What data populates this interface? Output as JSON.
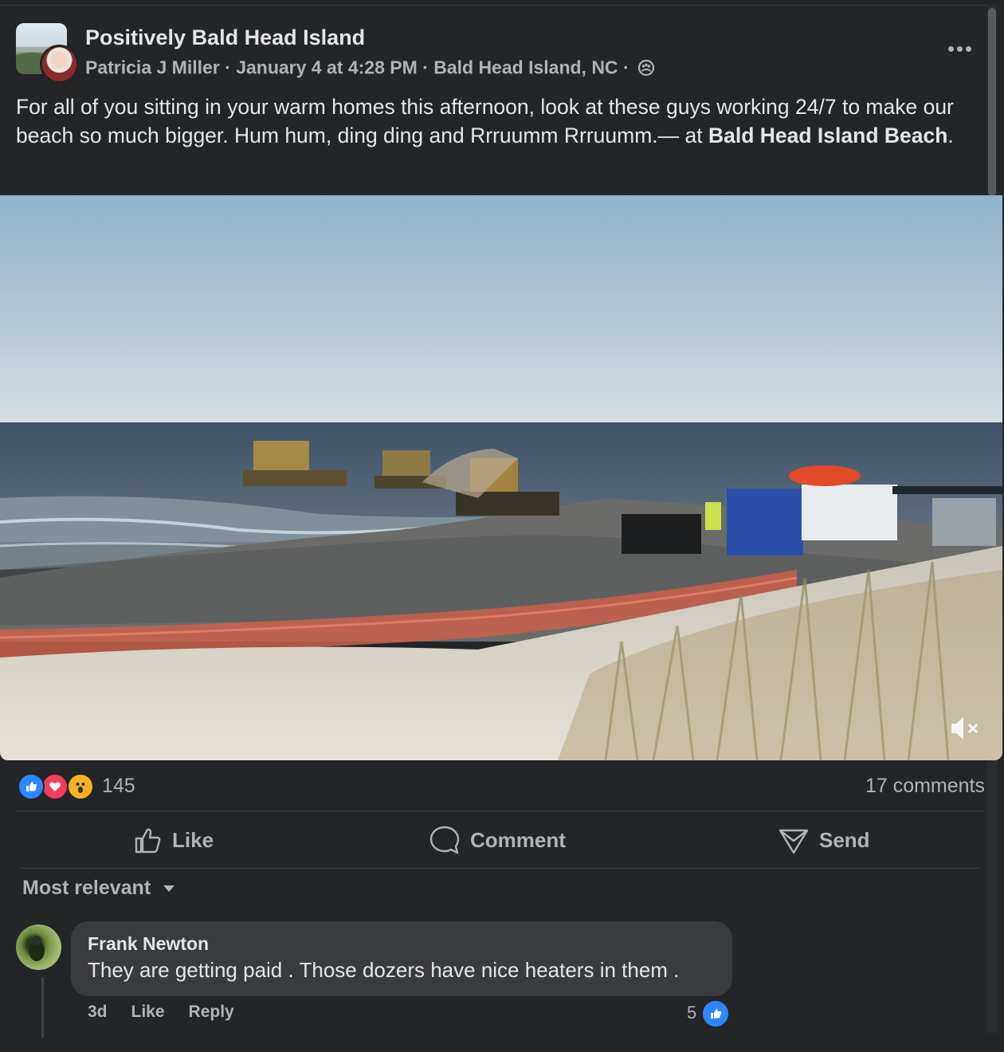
{
  "post": {
    "group_name": "Positively Bald Head Island",
    "author": "Patricia J Miller",
    "separator": "·",
    "date": "January 4 at 4:28 PM",
    "location": "Bald Head Island, NC",
    "privacy_icon": "group-privacy-icon",
    "text_before": "For all of you sitting in your warm homes this afternoon, look at these guys working 24/7 to make our beach so much bigger.  Hum hum, ding ding and Rrruumm Rrruumm.— at ",
    "tagged_place": "Bald Head Island Beach",
    "text_after": "."
  },
  "media": {
    "kind": "video",
    "muted": true,
    "mute_icon": "speaker-muted-icon"
  },
  "stats": {
    "reaction_icons": [
      "like-reaction-icon",
      "love-reaction-icon",
      "wow-reaction-icon"
    ],
    "reaction_count": "145",
    "comment_count": "17 comments"
  },
  "actions": {
    "like": "Like",
    "comment": "Comment",
    "send": "Send"
  },
  "comments_sort": "Most relevant",
  "comments": [
    {
      "name": "Frank Newton",
      "text": "They are getting paid . Those dozers have nice heaters in them .",
      "time": "3d",
      "like": "Like",
      "reply": "Reply",
      "like_count": "5"
    }
  ],
  "colors": {
    "background": "#242526",
    "bubble": "#3a3b3c",
    "text_primary": "#e4e6eb",
    "text_secondary": "#b0b3b8",
    "like_blue": "#2d88ff",
    "love_red": "#f33e58",
    "wow_yellow": "#f7b125"
  }
}
